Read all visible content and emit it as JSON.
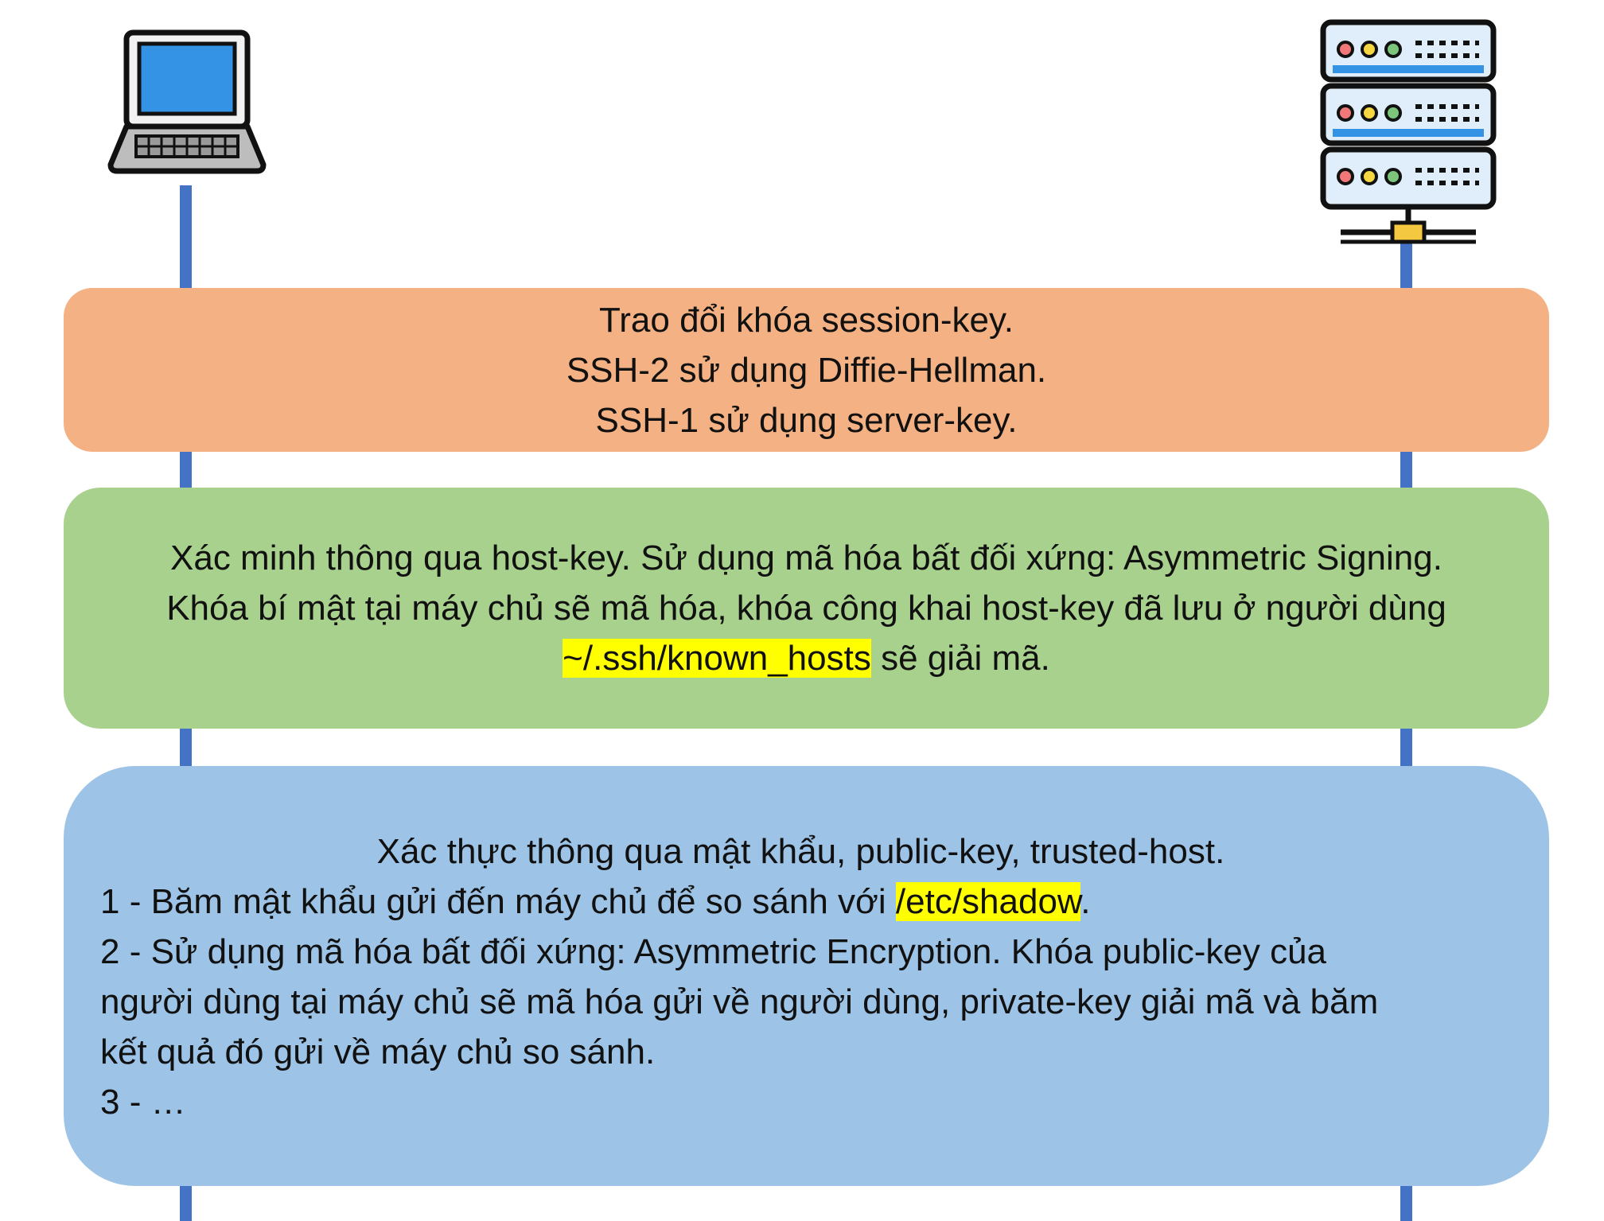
{
  "actors": {
    "client": {
      "icon": "laptop-icon"
    },
    "server": {
      "icon": "server-rack-icon"
    }
  },
  "colors": {
    "lifeline": "#4472c4",
    "session_box": "#f4b183",
    "host_box": "#a9d18e",
    "auth_box": "#9dc3e6",
    "highlight": "#ffff00"
  },
  "session_exchange": {
    "lines": [
      "Trao đổi khóa session-key.",
      "SSH-2 sử dụng Diffie-Hellman.",
      "SSH-1 sử dụng server-key."
    ]
  },
  "host_verification": {
    "line1": "Xác minh thông qua host-key. Sử dụng mã hóa bất đối xứng: Asymmetric Signing.",
    "line2": "Khóa bí mật tại máy chủ sẽ mã hóa, khóa công khai host-key đã lưu ở người dùng",
    "line3_highlight": "~/.ssh/known_hosts",
    "line3_rest": " sẽ giải mã."
  },
  "authentication": {
    "title": "Xác thực thông qua mật khẩu, public-key, trusted-host.",
    "item1_prefix": "1 - Băm mật khẩu gửi đến máy chủ để so sánh với ",
    "item1_highlight": "/etc/shadow",
    "item1_suffix": ".",
    "item2_line1": "2 - Sử dụng mã hóa bất đối xứng: Asymmetric Encryption. Khóa public-key của",
    "item2_line2": "người dùng tại máy chủ sẽ mã hóa gửi về người dùng, private-key giải mã và băm",
    "item2_line3": "kết quả đó gửi về máy chủ so sánh.",
    "item3": "3 - …"
  }
}
